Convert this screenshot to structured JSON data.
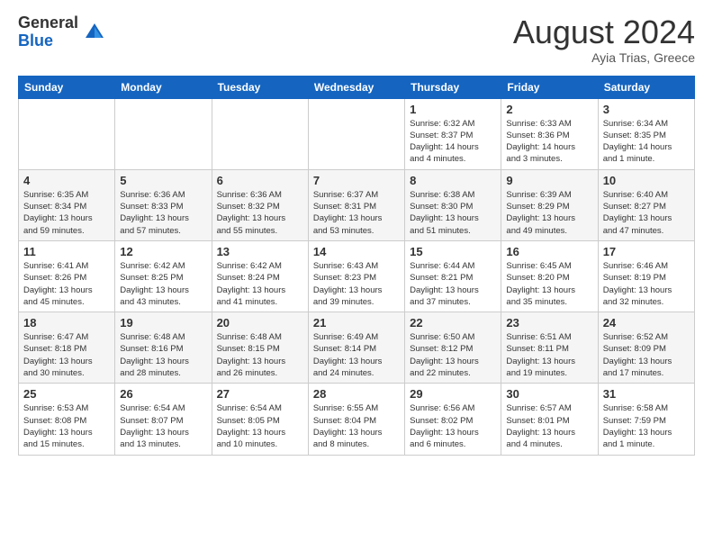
{
  "logo": {
    "general": "General",
    "blue": "Blue"
  },
  "title": "August 2024",
  "subtitle": "Ayia Trias, Greece",
  "days_of_week": [
    "Sunday",
    "Monday",
    "Tuesday",
    "Wednesday",
    "Thursday",
    "Friday",
    "Saturday"
  ],
  "weeks": [
    [
      {
        "day": "",
        "info": ""
      },
      {
        "day": "",
        "info": ""
      },
      {
        "day": "",
        "info": ""
      },
      {
        "day": "",
        "info": ""
      },
      {
        "day": "1",
        "info": "Sunrise: 6:32 AM\nSunset: 8:37 PM\nDaylight: 14 hours\nand 4 minutes."
      },
      {
        "day": "2",
        "info": "Sunrise: 6:33 AM\nSunset: 8:36 PM\nDaylight: 14 hours\nand 3 minutes."
      },
      {
        "day": "3",
        "info": "Sunrise: 6:34 AM\nSunset: 8:35 PM\nDaylight: 14 hours\nand 1 minute."
      }
    ],
    [
      {
        "day": "4",
        "info": "Sunrise: 6:35 AM\nSunset: 8:34 PM\nDaylight: 13 hours\nand 59 minutes."
      },
      {
        "day": "5",
        "info": "Sunrise: 6:36 AM\nSunset: 8:33 PM\nDaylight: 13 hours\nand 57 minutes."
      },
      {
        "day": "6",
        "info": "Sunrise: 6:36 AM\nSunset: 8:32 PM\nDaylight: 13 hours\nand 55 minutes."
      },
      {
        "day": "7",
        "info": "Sunrise: 6:37 AM\nSunset: 8:31 PM\nDaylight: 13 hours\nand 53 minutes."
      },
      {
        "day": "8",
        "info": "Sunrise: 6:38 AM\nSunset: 8:30 PM\nDaylight: 13 hours\nand 51 minutes."
      },
      {
        "day": "9",
        "info": "Sunrise: 6:39 AM\nSunset: 8:29 PM\nDaylight: 13 hours\nand 49 minutes."
      },
      {
        "day": "10",
        "info": "Sunrise: 6:40 AM\nSunset: 8:27 PM\nDaylight: 13 hours\nand 47 minutes."
      }
    ],
    [
      {
        "day": "11",
        "info": "Sunrise: 6:41 AM\nSunset: 8:26 PM\nDaylight: 13 hours\nand 45 minutes."
      },
      {
        "day": "12",
        "info": "Sunrise: 6:42 AM\nSunset: 8:25 PM\nDaylight: 13 hours\nand 43 minutes."
      },
      {
        "day": "13",
        "info": "Sunrise: 6:42 AM\nSunset: 8:24 PM\nDaylight: 13 hours\nand 41 minutes."
      },
      {
        "day": "14",
        "info": "Sunrise: 6:43 AM\nSunset: 8:23 PM\nDaylight: 13 hours\nand 39 minutes."
      },
      {
        "day": "15",
        "info": "Sunrise: 6:44 AM\nSunset: 8:21 PM\nDaylight: 13 hours\nand 37 minutes."
      },
      {
        "day": "16",
        "info": "Sunrise: 6:45 AM\nSunset: 8:20 PM\nDaylight: 13 hours\nand 35 minutes."
      },
      {
        "day": "17",
        "info": "Sunrise: 6:46 AM\nSunset: 8:19 PM\nDaylight: 13 hours\nand 32 minutes."
      }
    ],
    [
      {
        "day": "18",
        "info": "Sunrise: 6:47 AM\nSunset: 8:18 PM\nDaylight: 13 hours\nand 30 minutes."
      },
      {
        "day": "19",
        "info": "Sunrise: 6:48 AM\nSunset: 8:16 PM\nDaylight: 13 hours\nand 28 minutes."
      },
      {
        "day": "20",
        "info": "Sunrise: 6:48 AM\nSunset: 8:15 PM\nDaylight: 13 hours\nand 26 minutes."
      },
      {
        "day": "21",
        "info": "Sunrise: 6:49 AM\nSunset: 8:14 PM\nDaylight: 13 hours\nand 24 minutes."
      },
      {
        "day": "22",
        "info": "Sunrise: 6:50 AM\nSunset: 8:12 PM\nDaylight: 13 hours\nand 22 minutes."
      },
      {
        "day": "23",
        "info": "Sunrise: 6:51 AM\nSunset: 8:11 PM\nDaylight: 13 hours\nand 19 minutes."
      },
      {
        "day": "24",
        "info": "Sunrise: 6:52 AM\nSunset: 8:09 PM\nDaylight: 13 hours\nand 17 minutes."
      }
    ],
    [
      {
        "day": "25",
        "info": "Sunrise: 6:53 AM\nSunset: 8:08 PM\nDaylight: 13 hours\nand 15 minutes."
      },
      {
        "day": "26",
        "info": "Sunrise: 6:54 AM\nSunset: 8:07 PM\nDaylight: 13 hours\nand 13 minutes."
      },
      {
        "day": "27",
        "info": "Sunrise: 6:54 AM\nSunset: 8:05 PM\nDaylight: 13 hours\nand 10 minutes."
      },
      {
        "day": "28",
        "info": "Sunrise: 6:55 AM\nSunset: 8:04 PM\nDaylight: 13 hours\nand 8 minutes."
      },
      {
        "day": "29",
        "info": "Sunrise: 6:56 AM\nSunset: 8:02 PM\nDaylight: 13 hours\nand 6 minutes."
      },
      {
        "day": "30",
        "info": "Sunrise: 6:57 AM\nSunset: 8:01 PM\nDaylight: 13 hours\nand 4 minutes."
      },
      {
        "day": "31",
        "info": "Sunrise: 6:58 AM\nSunset: 7:59 PM\nDaylight: 13 hours\nand 1 minute."
      }
    ]
  ]
}
